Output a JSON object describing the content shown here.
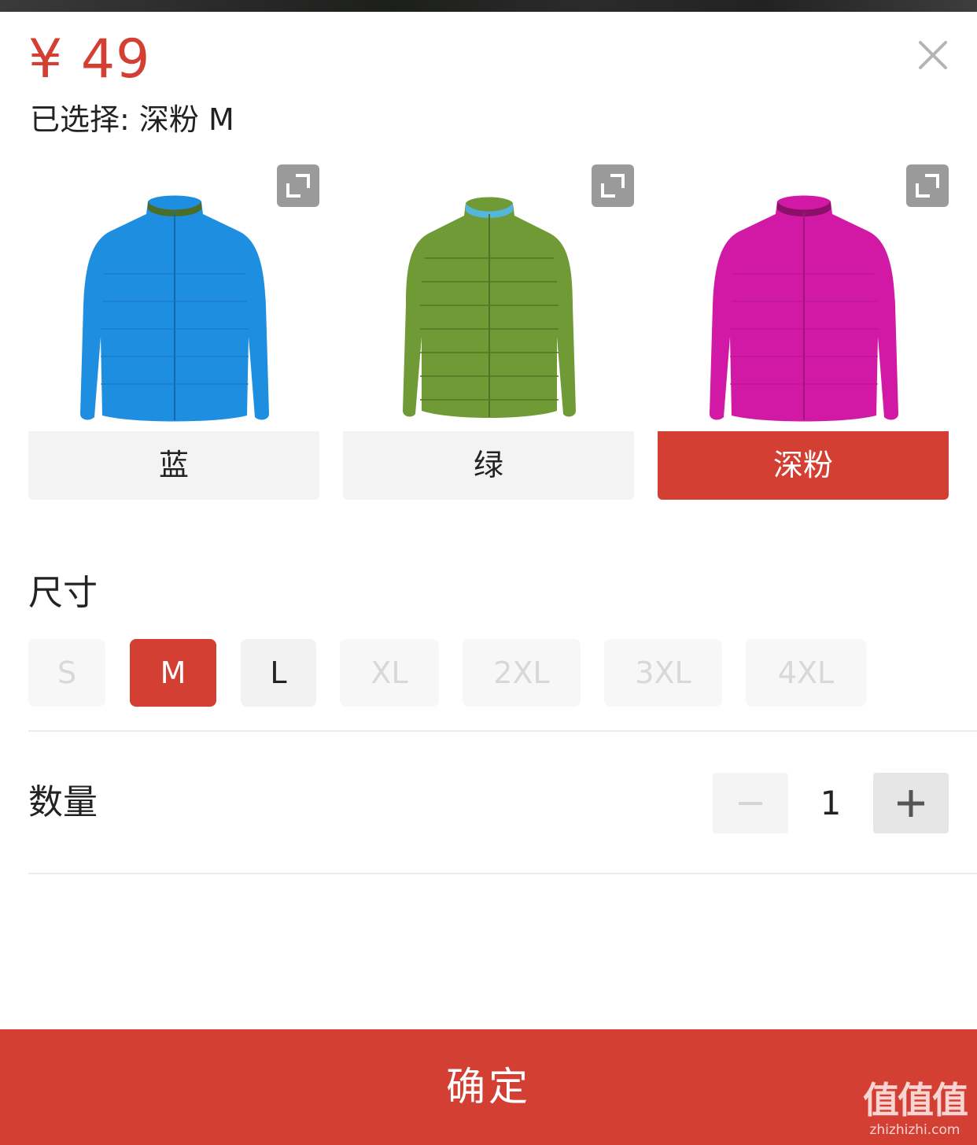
{
  "header": {
    "price": "¥ 49",
    "selected_text": "已选择: 深粉 M"
  },
  "variants": [
    {
      "label": "蓝",
      "color": "#1e8fe0",
      "active": false
    },
    {
      "label": "绿",
      "color": "#6f9a36",
      "active": false
    },
    {
      "label": "深粉",
      "color": "#d219a5",
      "active": true
    }
  ],
  "size_section": {
    "title": "尺寸",
    "options": [
      {
        "label": "S",
        "state": "disabled"
      },
      {
        "label": "M",
        "state": "selected"
      },
      {
        "label": "L",
        "state": "available"
      },
      {
        "label": "XL",
        "state": "disabled"
      },
      {
        "label": "2XL",
        "state": "disabled"
      },
      {
        "label": "3XL",
        "state": "disabled"
      },
      {
        "label": "4XL",
        "state": "disabled"
      }
    ]
  },
  "quantity_section": {
    "title": "数量",
    "value": "1"
  },
  "footer": {
    "confirm_label": "确定"
  },
  "watermark": {
    "big": "值值值",
    "small": "zhizhizhi.com"
  },
  "colors": {
    "accent": "#d43f33",
    "chip_bg": "#f3f3f3",
    "disabled_text": "#d8d8d8"
  },
  "icons": [
    "close-icon",
    "expand-icon",
    "minus-icon",
    "plus-icon"
  ]
}
